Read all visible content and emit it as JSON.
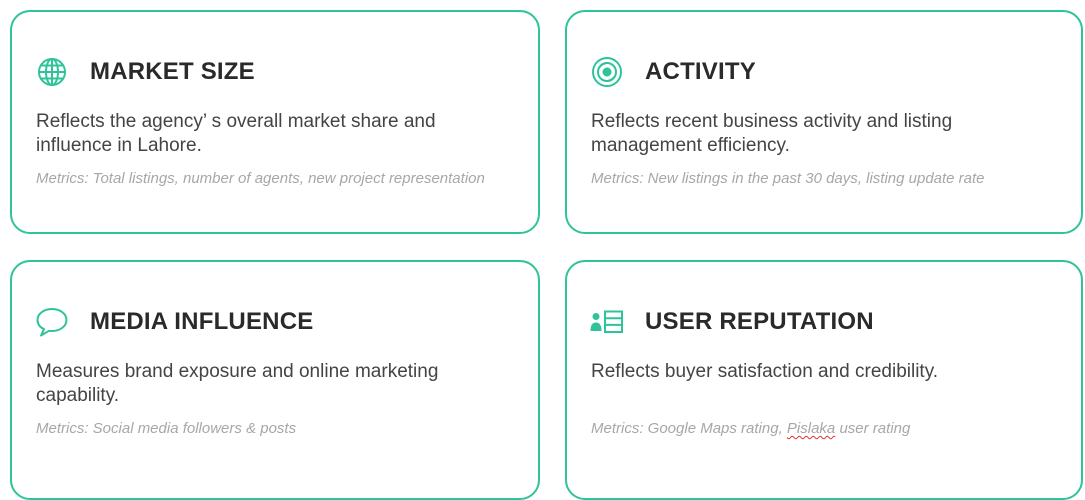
{
  "colors": {
    "accent": "#2fc39a",
    "title": "#2a2a2a",
    "body": "#444444",
    "metrics": "#a7a7a7"
  },
  "cards": [
    {
      "icon": "globe-icon",
      "title": "MARKET SIZE",
      "description": "Reflects the agency’ s overall market share and influence in Lahore.",
      "metrics": "Metrics: Total listings, number of agents, new project representation"
    },
    {
      "icon": "vinyl-disc-icon",
      "title": "ACTIVITY",
      "description": "Reflects recent business activity and listing management efficiency.",
      "metrics": "Metrics: New listings in the past 30 days, listing update rate"
    },
    {
      "icon": "speech-bubble-icon",
      "title": "MEDIA INFLUENCE",
      "description": "Measures brand exposure and online marketing capability.",
      "metrics": "Metrics: Social media followers & posts"
    },
    {
      "icon": "user-list-icon",
      "title": "USER REPUTATION",
      "description": "Reflects buyer satisfaction and credibility.",
      "metrics_prefix": "Metrics: Google Maps rating, ",
      "metrics_flagged": "Pislaka",
      "metrics_suffix": " user rating"
    }
  ]
}
